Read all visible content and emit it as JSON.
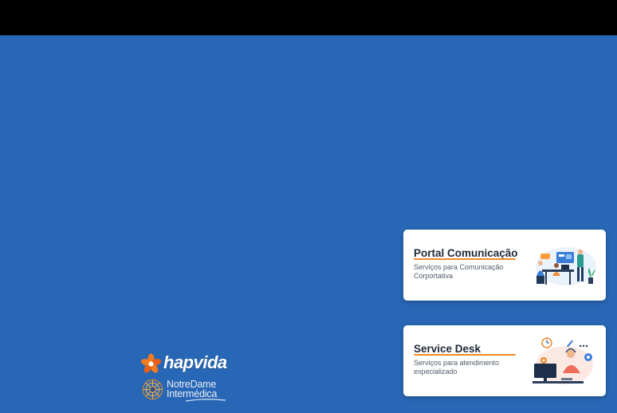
{
  "colors": {
    "background_blue": "#2867b5",
    "top_bar": "#000000",
    "card_background": "#ffffff",
    "accent_orange": "#f08a2c",
    "title_text": "#1f2a38",
    "description_text": "#4f5b6a"
  },
  "brand": {
    "hapvida_word": "hapvida",
    "hapvida_icon": "hapvida-flower-logo",
    "notredame_line1": "NotreDame",
    "notredame_line2": "Intermédica",
    "notredame_icon": "notredame-medallion-logo"
  },
  "cards": [
    {
      "title": "Portal Comunicação",
      "description": "Serviços para Comunicação Corportativa",
      "illustration": "team-meeting-illustration"
    },
    {
      "title": "Service Desk",
      "description": "Serviços para atendimento especializado",
      "illustration": "support-agent-illustration"
    }
  ]
}
